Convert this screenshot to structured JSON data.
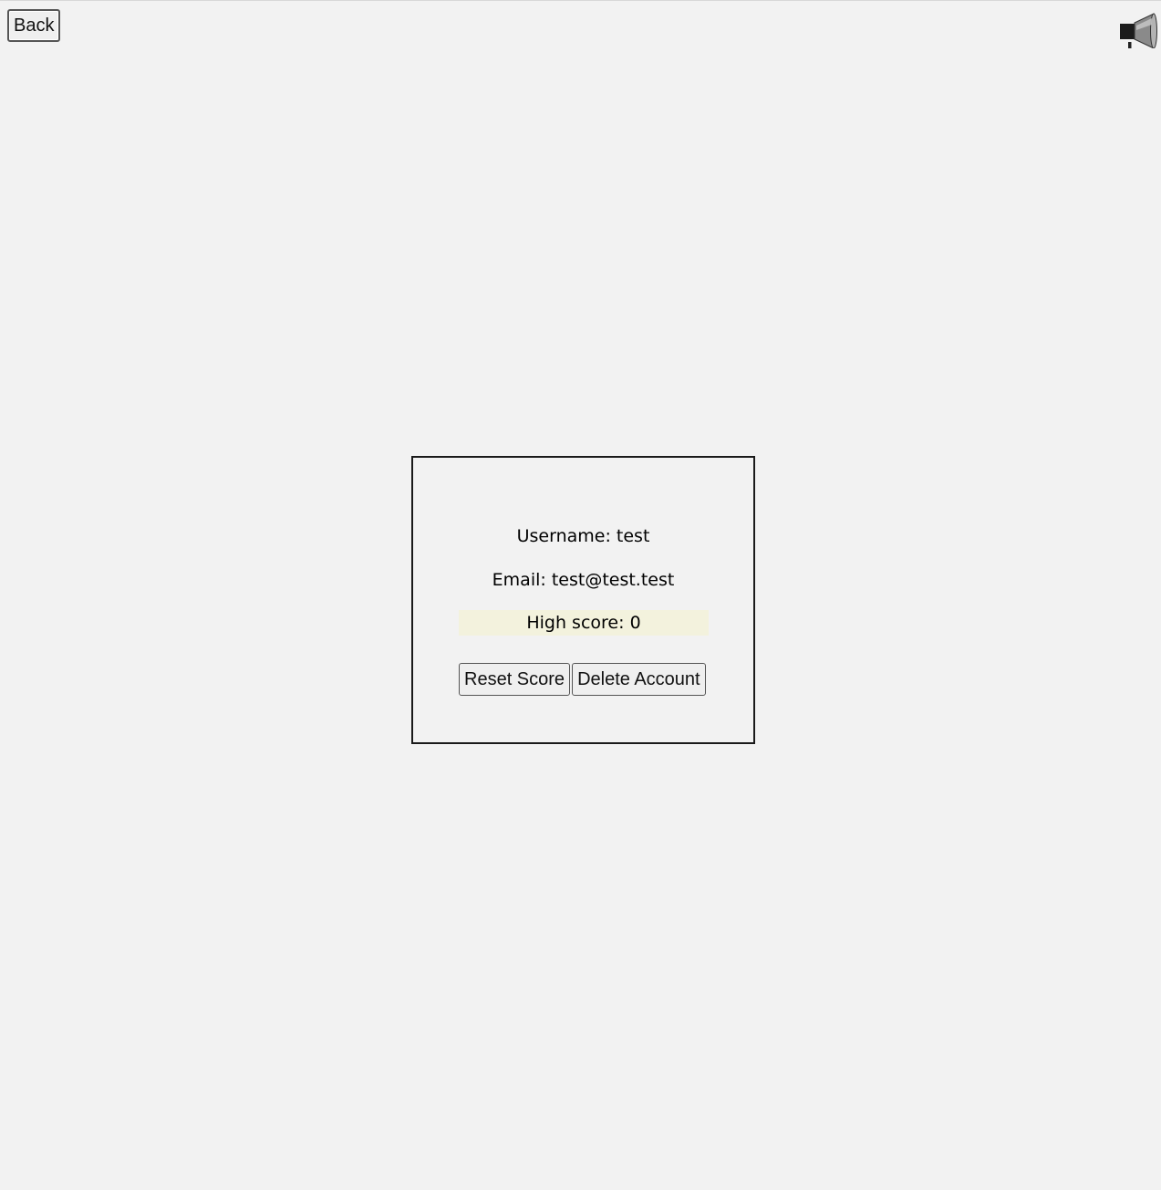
{
  "header": {
    "back_label": "Back",
    "sound_icon": "megaphone-icon"
  },
  "profile": {
    "username_label": "Username:",
    "username_value": "test",
    "email_label": "Email:",
    "email_value": "test@test.test",
    "highscore_label": "High score:",
    "highscore_value": "0",
    "reset_label": "Reset Score",
    "delete_label": "Delete Account"
  },
  "colors": {
    "background": "#f2f2f2",
    "highscore_bg": "#f3f2dd",
    "border": "#1a1a1a"
  }
}
